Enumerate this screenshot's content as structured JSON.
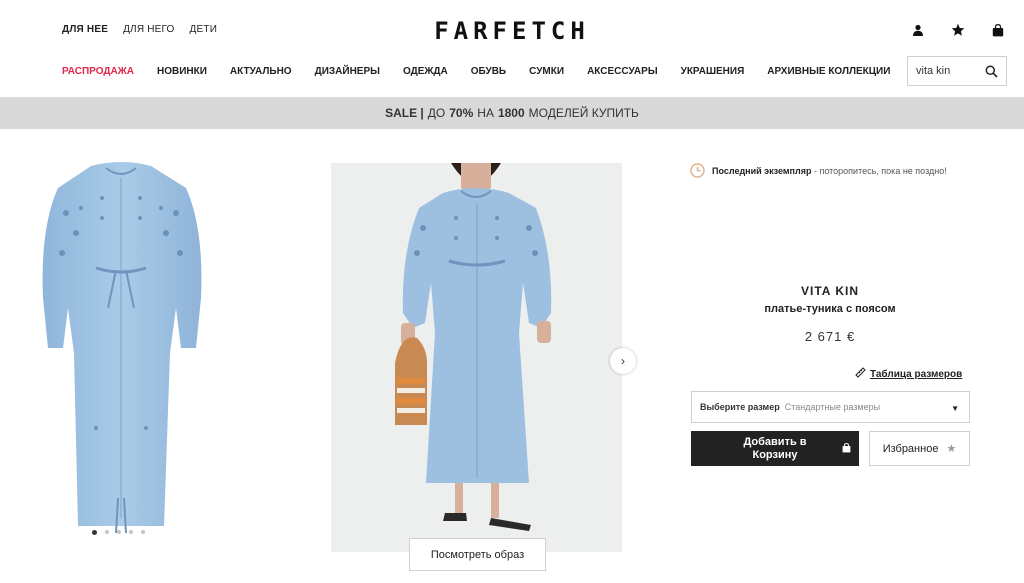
{
  "header": {
    "gender_tabs": [
      "ДЛЯ НЕЕ",
      "ДЛЯ НЕГО",
      "ДЕТИ"
    ],
    "logo": "FARFETCH",
    "icons": [
      "account-icon",
      "wishlist-star-icon",
      "bag-icon"
    ]
  },
  "nav": {
    "items": [
      "РАСПРОДАЖА",
      "НОВИНКИ",
      "АКТУАЛЬНО",
      "ДИЗАЙНЕРЫ",
      "ОДЕЖДА",
      "ОБУВЬ",
      "СУМКИ",
      "АКСЕССУАРЫ",
      "УКРАШЕНИЯ",
      "АРХИВНЫЕ КОЛЛЕКЦИИ"
    ],
    "sale_color": "#e0294a"
  },
  "search": {
    "value": "vita kin"
  },
  "promo": {
    "sale": "SALE |",
    "prefix": "ДО",
    "percent": "70%",
    "middle": "НА",
    "count": "1800",
    "suffix": "МОДЕЛЕЙ КУПИТЬ"
  },
  "gallery": {
    "dots_count": 5,
    "active_dot": 0,
    "look_button": "Посмотреть образ",
    "dress_color": "#9fc3e3"
  },
  "product": {
    "stock_bold": "Последний экземпляр",
    "stock_rest": "- потоpопитесь, пока не поздно!",
    "brand": "VITA KIN",
    "name": "платье-туника с поясом",
    "price": "2 671 €",
    "size_guide": "Таблица размеров",
    "size_label": "Выберите размер",
    "size_placeholder": "Стандартные размеры",
    "add_to_cart_line1": "Добавить в",
    "add_to_cart_line2": "Корзину",
    "wishlist": "Избранное"
  }
}
